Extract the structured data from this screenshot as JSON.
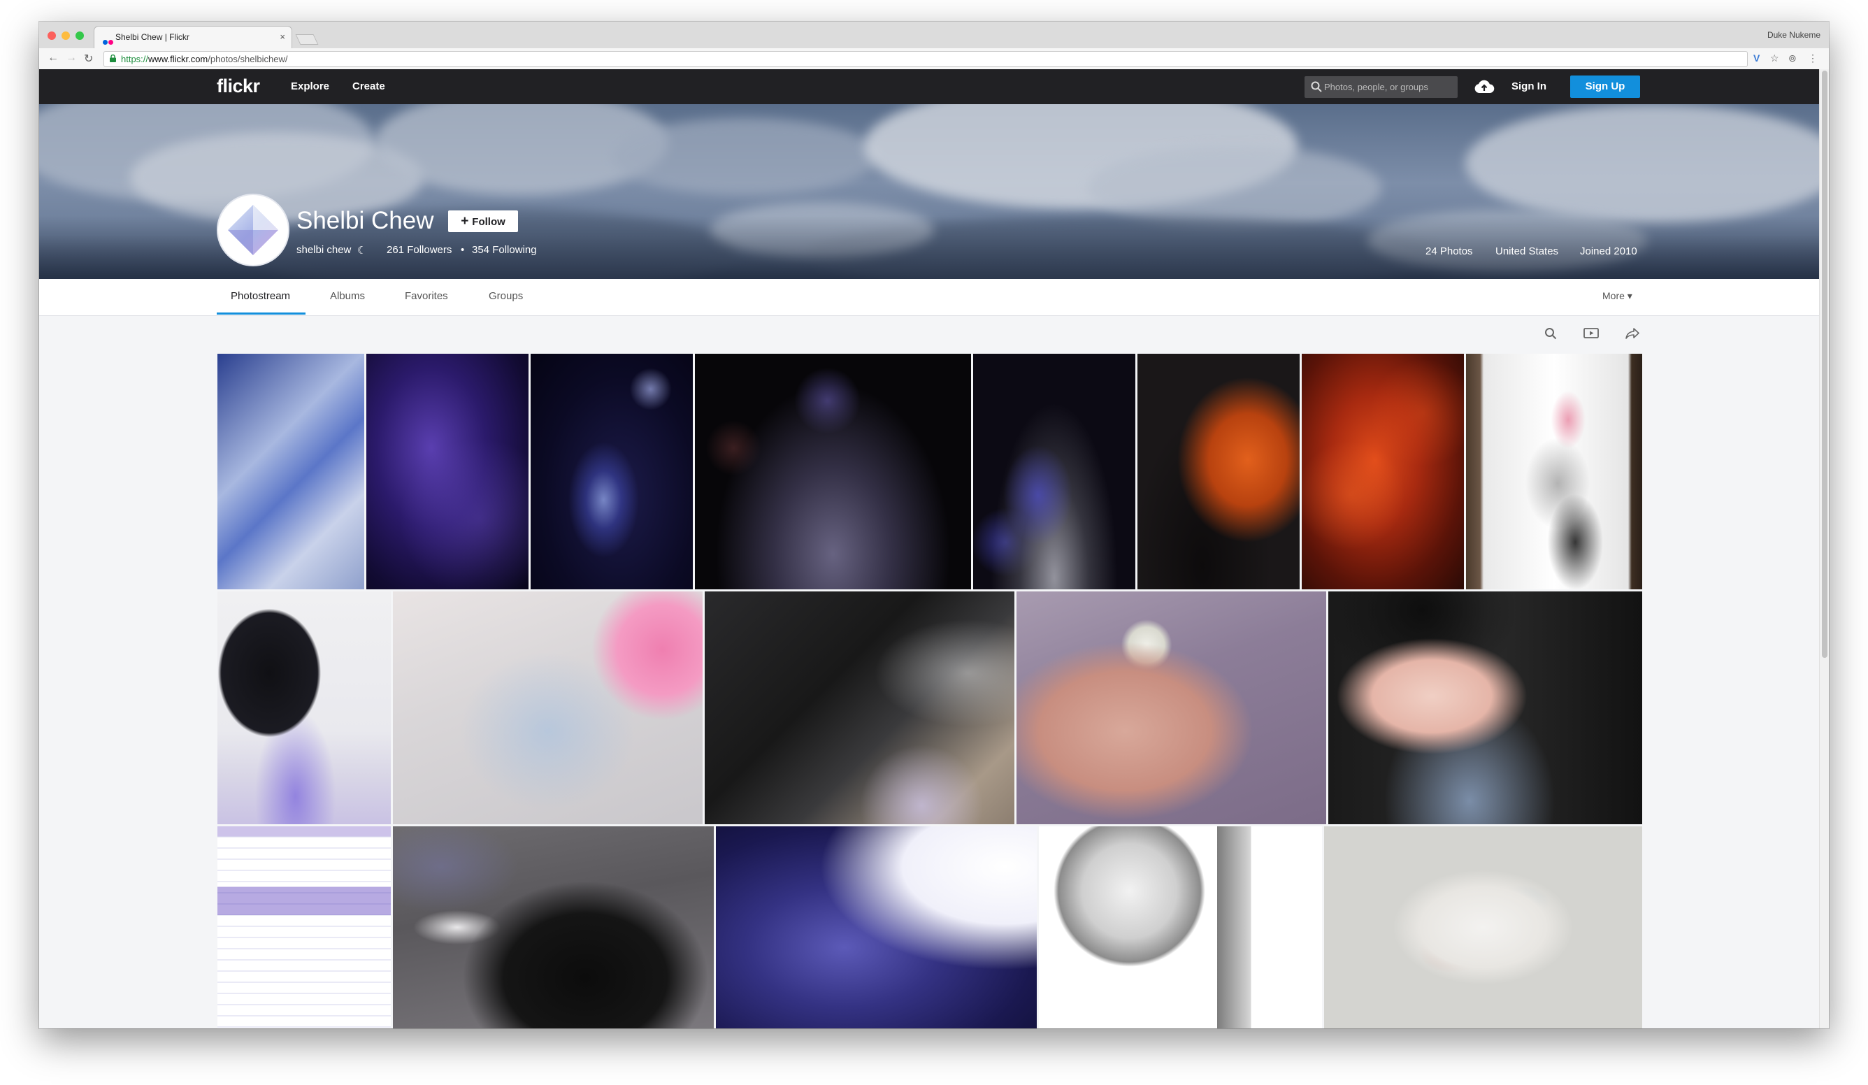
{
  "browser": {
    "tab_title": "Shelbi Chew | Flickr",
    "tab_close": "×",
    "profile_name": "Duke Nukeme",
    "url_scheme": "https://",
    "url_host": "www.flickr.com",
    "url_path": "/photos/shelbichew/",
    "back_glyph": "←",
    "forward_glyph": "→",
    "reload_glyph": "↻"
  },
  "nav": {
    "logo": "flickr",
    "explore": "Explore",
    "create": "Create",
    "search_placeholder": "Photos, people, or groups",
    "sign_in": "Sign In",
    "sign_up": "Sign Up"
  },
  "profile": {
    "name": "Shelbi Chew",
    "follow_label": "Follow",
    "follow_plus": "+",
    "username": "shelbi chew",
    "moon": "☾",
    "followers": "261 Followers",
    "bullet": "•",
    "following": "354 Following",
    "photos": "24 Photos",
    "country": "United States",
    "joined": "Joined 2010"
  },
  "subnav": {
    "tabs": [
      "Photostream",
      "Albums",
      "Favorites",
      "Groups"
    ],
    "active": "Photostream",
    "more": "More ▾"
  },
  "icons": {
    "search": "search-icon",
    "slideshow": "slideshow-icon",
    "share": "share-icon",
    "upload": "cloud-upload-icon",
    "lock": "lock-icon"
  },
  "colors": {
    "accent": "#128fdc",
    "nav_bg": "#212124",
    "page_bg": "#f4f5f7"
  }
}
